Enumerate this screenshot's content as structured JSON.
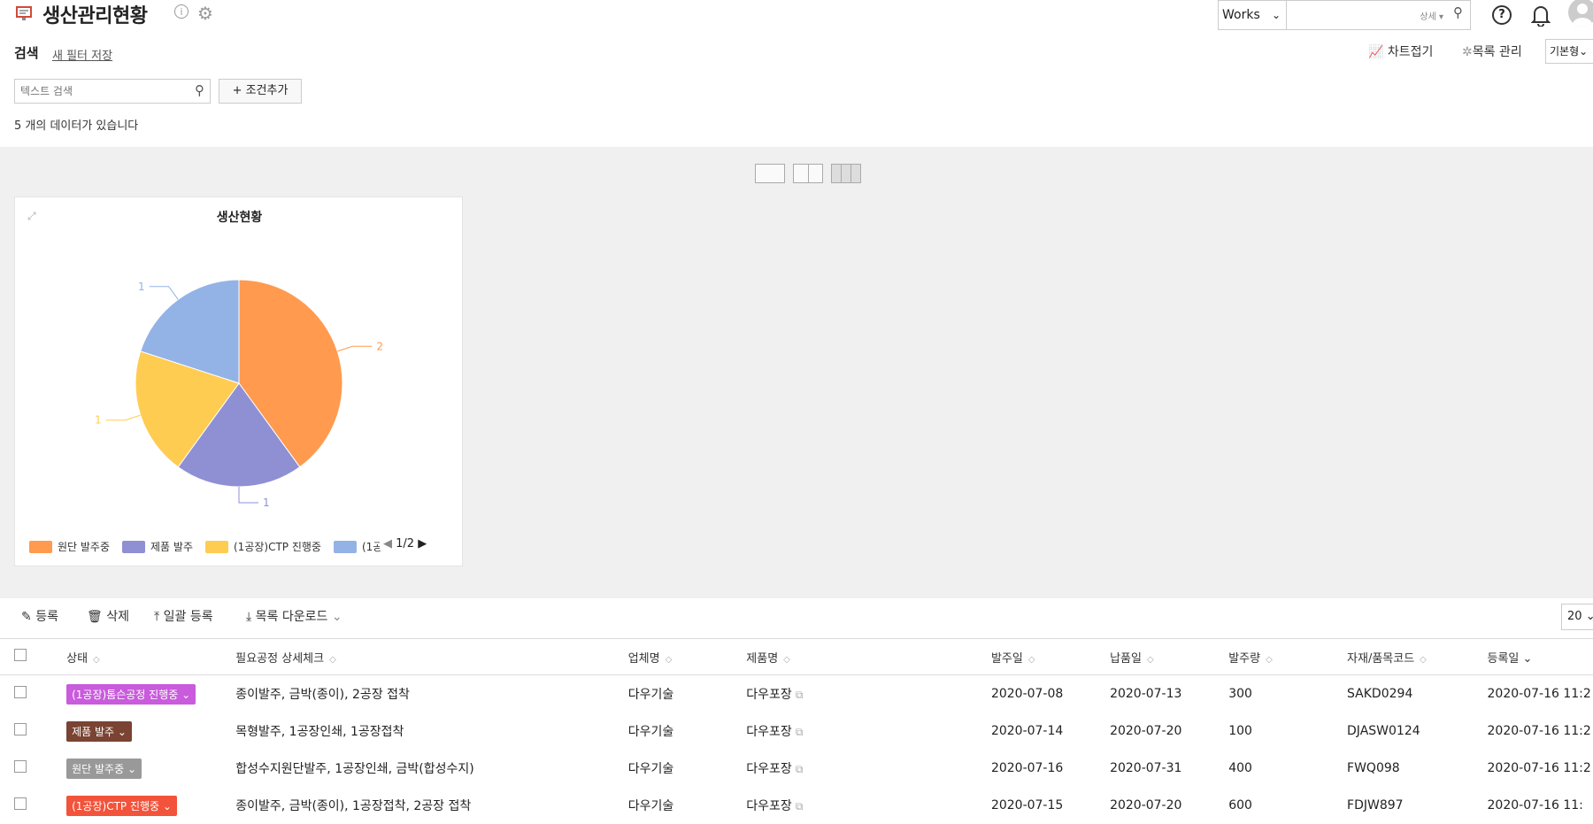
{
  "header": {
    "title": "생산관리현황",
    "app_select": "Works",
    "search_detail": "상세",
    "help": "?"
  },
  "search_bar": {
    "label": "검색",
    "save_filter": "새 필터 저장",
    "chart_toggle": "차트접기",
    "list_manage": "목록 관리",
    "view_type": "기본형",
    "text_placeholder": "텍스트 검색",
    "add_condition": "+ 조건추가",
    "count_text": "5 개의 데이터가 있습니다"
  },
  "chart_data": {
    "type": "pie",
    "title": "생산현황",
    "slices": [
      {
        "label": "원단 발주중",
        "value": 2,
        "color": "#ff9a4f"
      },
      {
        "label": "제품 발주",
        "value": 1,
        "color": "#8f8fd4"
      },
      {
        "label": "(1공장)CTP 진행중",
        "value": 1,
        "color": "#ffcc52"
      },
      {
        "label": "(1공",
        "value": 1,
        "color": "#93b3e7"
      }
    ],
    "legend": {
      "page": "1/2",
      "placement": "bottom"
    }
  },
  "toolbar": {
    "register": "등록",
    "delete": "삭제",
    "bulk_register": "일괄 등록",
    "download": "목록 다운로드",
    "page_size": "20"
  },
  "table": {
    "columns": [
      "상태",
      "필요공정 상세체크",
      "업체명",
      "제품명",
      "발주일",
      "납품일",
      "발주량",
      "자재/품목코드",
      "등록일"
    ],
    "rows": [
      {
        "status": "(1공장)톰슨공정 진행중",
        "status_color": "#c95bdc",
        "process": "종이발주, 금박(종이), 2공장 접착",
        "company": "다우기술",
        "product": "다우포장",
        "order_date": "2020-07-08",
        "delivery_date": "2020-07-13",
        "qty": "300",
        "code": "SAKD0294",
        "reg": "2020-07-16 11:2"
      },
      {
        "status": "제품 발주",
        "status_color": "#7a4332",
        "process": "목형발주, 1공장인쇄, 1공장접착",
        "company": "다우기술",
        "product": "다우포장",
        "order_date": "2020-07-14",
        "delivery_date": "2020-07-20",
        "qty": "100",
        "code": "DJASW0124",
        "reg": "2020-07-16 11:2"
      },
      {
        "status": "원단 발주중",
        "status_color": "#999999",
        "process": "합성수지원단발주, 1공장인쇄, 금박(합성수지)",
        "company": "다우기술",
        "product": "다우포장",
        "order_date": "2020-07-16",
        "delivery_date": "2020-07-31",
        "qty": "400",
        "code": "FWQ098",
        "reg": "2020-07-16 11:2"
      },
      {
        "status": "(1공장)CTP 진행중",
        "status_color": "#f2533a",
        "process": "종이발주, 금박(종이), 1공장접착, 2공장 접착",
        "company": "다우기술",
        "product": "다우포장",
        "order_date": "2020-07-15",
        "delivery_date": "2020-07-20",
        "qty": "600",
        "code": "FDJW897",
        "reg": "2020-07-16 11:"
      }
    ]
  }
}
